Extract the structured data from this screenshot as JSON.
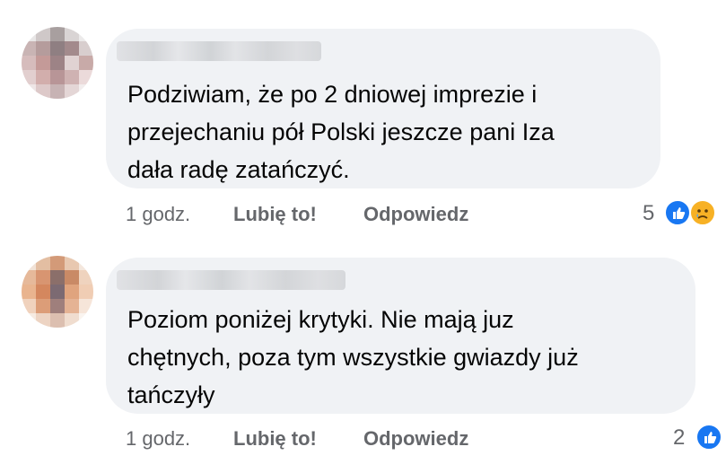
{
  "comments": [
    {
      "text": "Podziwiam, że po 2 dniowej imprezie i\nprzejechaniu pół Polski jeszcze pani Iza\ndała radę zatańczyć.",
      "time": "1 godz.",
      "like_label": "Lubię to!",
      "reply_label": "Odpowiedz",
      "reaction_count": "5",
      "reactions": [
        "like-icon",
        "sad-icon"
      ]
    },
    {
      "text": "Poziom poniżej krytyki. Nie mają juz\nchętnych, poza tym wszystkie gwiazdy już\ntańczyły",
      "time": "1 godz.",
      "like_label": "Lubię to!",
      "reply_label": "Odpowiedz",
      "reaction_count": "2",
      "reactions": [
        "like-icon"
      ]
    }
  ],
  "colors": {
    "bubble": "#f0f2f5",
    "meta_text": "#65676b",
    "like_blue": "#1877f2",
    "sad_yellow": "#f7b125"
  }
}
